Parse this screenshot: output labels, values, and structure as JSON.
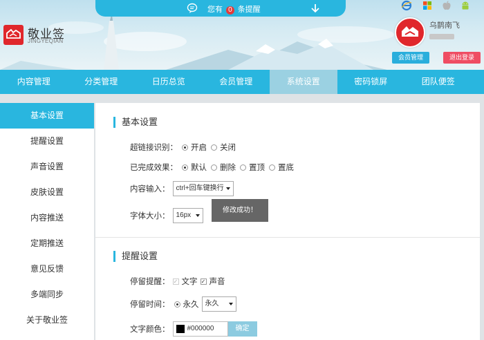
{
  "header": {
    "logo_title": "敬业签",
    "logo_sub": "JINGYEQIAN",
    "notice": {
      "prefix": "您有",
      "count": "0",
      "suffix": "条提醒"
    },
    "platform_icons": [
      "ie-icon",
      "windows-icon",
      "apple-icon",
      "android-icon"
    ],
    "username": "乌鹊南飞",
    "member_button": "会员管理",
    "logout_button": "退出登录"
  },
  "nav": {
    "items": [
      "内容管理",
      "分类管理",
      "日历总览",
      "会员管理",
      "系统设置",
      "密码锁屏",
      "团队便签"
    ],
    "active_index": 4
  },
  "sidebar": {
    "items": [
      "基本设置",
      "提醒设置",
      "声音设置",
      "皮肤设置",
      "内容推送",
      "定期推送",
      "意见反馈",
      "多端同步",
      "关于敬业签"
    ],
    "active_index": 0
  },
  "basic": {
    "title": "基本设置",
    "hyperlink": {
      "label": "超链接识别：",
      "options": [
        "开启",
        "关闭"
      ],
      "selected": 0
    },
    "completed": {
      "label": "已完成效果：",
      "options": [
        "默认",
        "删除",
        "置顶",
        "置底"
      ],
      "selected": 0
    },
    "content_input": {
      "label": "内容输入：",
      "value": "ctrl+回车键换行"
    },
    "font_size": {
      "label": "字体大小：",
      "value": "16px"
    },
    "toast": "修改成功！"
  },
  "reminder": {
    "title": "提醒设置",
    "stay": {
      "label": "停留提醒：",
      "options": [
        "文字",
        "声音"
      ]
    },
    "stay_time": {
      "label": "停留时间：",
      "radio_label": "永久",
      "select_value": "永久"
    },
    "text_color": {
      "label": "文字颜色：",
      "value": "#000000",
      "confirm": "确定"
    }
  },
  "colors": {
    "primary": "#29b6df",
    "nav_active": "#9bd1e2",
    "logo_red": "#e0272c",
    "logout_pink": "#ef4d63"
  }
}
